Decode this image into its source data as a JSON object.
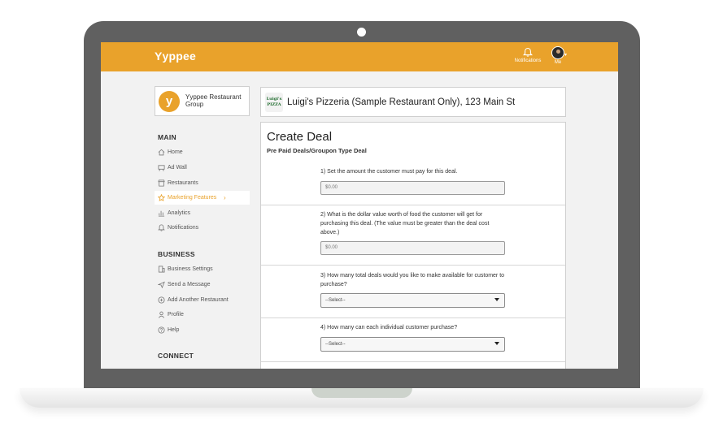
{
  "app": {
    "logo": "Yyppee"
  },
  "header": {
    "notifications_label": "Notifications",
    "me_label": "Me"
  },
  "org": {
    "badge": "y",
    "name": "Yyppee Restaurant Group"
  },
  "sidebar": {
    "main_title": "MAIN",
    "main_items": [
      {
        "label": "Home",
        "icon": "home-icon"
      },
      {
        "label": "Ad Wall",
        "icon": "ad-wall-icon"
      },
      {
        "label": "Restaurants",
        "icon": "store-icon"
      },
      {
        "label": "Marketing Features",
        "icon": "star-icon",
        "active": true
      },
      {
        "label": "Analytics",
        "icon": "chart-icon"
      },
      {
        "label": "Notifications",
        "icon": "bell-icon"
      }
    ],
    "business_title": "BUSINESS",
    "business_items": [
      {
        "label": "Business Settings",
        "icon": "building-icon"
      },
      {
        "label": "Send a Message",
        "icon": "send-icon"
      },
      {
        "label": "Add Another Restaurant",
        "icon": "plus-circle-icon"
      },
      {
        "label": "Profile",
        "icon": "user-icon"
      },
      {
        "label": "Help",
        "icon": "help-icon"
      }
    ],
    "connect_title": "CONNECT"
  },
  "restaurant": {
    "logo_text": "Luigi's PIZZA",
    "name": "Luigi's Pizzeria (Sample Restaurant Only), 123 Main St"
  },
  "deal": {
    "title": "Create Deal",
    "subtitle": "Pre Paid Deals/Groupon Type Deal",
    "q1": "1) Set the amount the customer must pay for this deal.",
    "q1_value": "$0.00",
    "q2": "2) What is the dollar value worth of food the customer will get for purchasing this deal. (The value must be greater than the deal cost above.)",
    "q2_value": "$0.00",
    "q3": "3) How many total deals would you like to make available for customer to purchase?",
    "q3_value": "--Select--",
    "q4": "4) How many can each individual customer purchase?",
    "q4_value": "--Select--"
  },
  "colors": {
    "accent": "#e9a22b",
    "laptop_frame": "#606060",
    "screen_bg": "#f2f2f2"
  }
}
